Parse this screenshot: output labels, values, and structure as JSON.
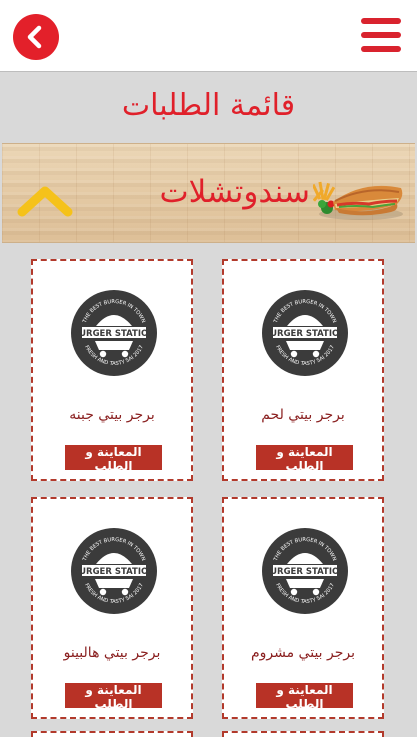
{
  "header": {
    "back_icon": "chevron-left-icon",
    "menu_icon": "hamburger-menu-icon"
  },
  "page": {
    "title": "قائمة الطلبات"
  },
  "category": {
    "title": "سندوتشلات",
    "toggle_icon": "chevron-up-icon",
    "image_icon": "sandwich-icon"
  },
  "colors": {
    "accent": "#e0202a",
    "button": "#b83226",
    "card_border": "#b23a2c",
    "product_text": "#8a1f1f"
  },
  "products": [
    {
      "name": "برجر بيتي لحم",
      "button_label": "المعاينة و الطلب"
    },
    {
      "name": "برجر بيتي جبنه",
      "button_label": "المعاينة و الطلب"
    },
    {
      "name": "برجر بيتي مشروم",
      "button_label": "المعاينة و الطلب"
    },
    {
      "name": "برجر بيتي هالبينو",
      "button_label": "المعاينة و الطلب"
    }
  ],
  "logo": {
    "brand": "BURGER STATION",
    "tagline_top": "THE BEST BURGER IN TOWN",
    "tagline_bottom": "FRESH AND TASTY SAI 2017"
  }
}
